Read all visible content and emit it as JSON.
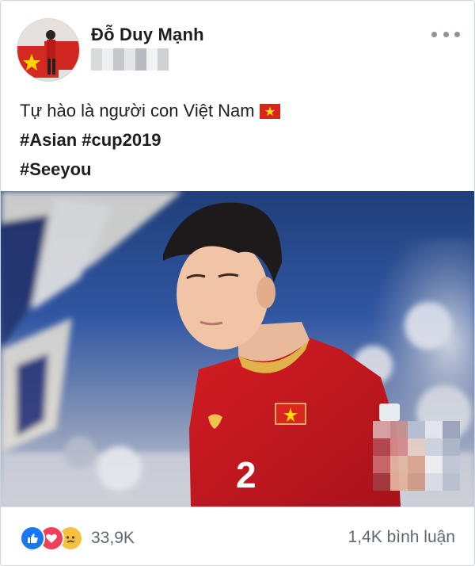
{
  "post": {
    "author": "Đỗ Duy Mạnh",
    "text_line1": "Tự hào là người con Việt Nam",
    "text_line1_emoji": "vietnam-flag-emoji",
    "hashtags_line2": "#Asian #cup2019",
    "hashtags_line3": "#Seeyou",
    "jersey_number": "2"
  },
  "footer": {
    "reaction_icons": [
      "like-icon",
      "love-icon",
      "sad-icon"
    ],
    "reaction_count": "33,9K",
    "comments": "1,4K bình luận"
  },
  "colors": {
    "like": "#1877f2",
    "love": "#f33e58",
    "sad": "#f7c03d",
    "jersey_red": "#c8161d",
    "flag_red": "#da251d",
    "flag_star": "#ffde00"
  }
}
